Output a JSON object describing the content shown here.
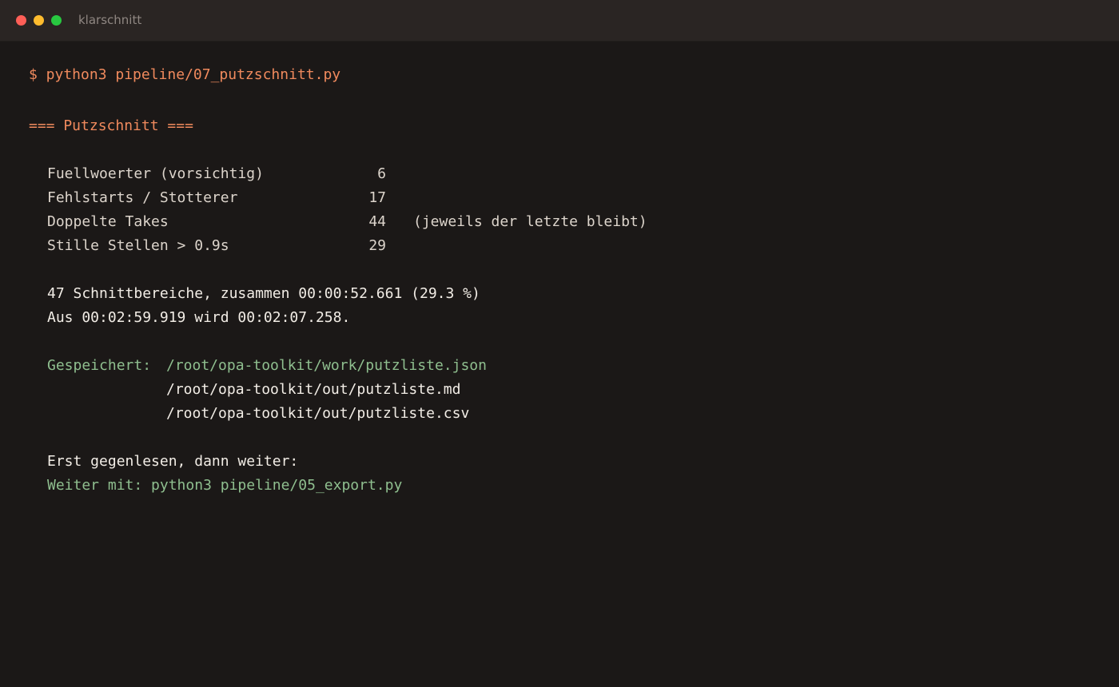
{
  "window": {
    "title": "klarschnitt"
  },
  "terminal": {
    "command": "$ python3 pipeline/07_putzschnitt.py",
    "section_header": "=== Putzschnitt ===",
    "stats": [
      {
        "label": "Fuellwoerter (vorsichtig)",
        "count": "6",
        "note": ""
      },
      {
        "label": "Fehlstarts / Stotterer",
        "count": "17",
        "note": ""
      },
      {
        "label": "Doppelte Takes",
        "count": "44",
        "note": "(jeweils der letzte bleibt)"
      },
      {
        "label": "Stille Stellen > 0.9s",
        "count": "29",
        "note": ""
      }
    ],
    "summary_line_1": "47 Schnittbereiche, zusammen 00:00:52.661 (29.3 %)",
    "summary_line_2": "Aus 00:02:59.919 wird 00:02:07.258.",
    "saved_label": "Gespeichert:",
    "saved_files": [
      "/root/opa-toolkit/work/putzliste.json",
      "/root/opa-toolkit/out/putzliste.md",
      "/root/opa-toolkit/out/putzliste.csv"
    ],
    "review_hint": "Erst gegenlesen, dann weiter:",
    "next_step": "Weiter mit: python3 pipeline/05_export.py"
  },
  "colors": {
    "background": "#1b1817",
    "titlebar": "#2a2523",
    "accent_orange": "#f08a5d",
    "accent_green": "#8fbf8f",
    "text": "#e3ddd6"
  }
}
